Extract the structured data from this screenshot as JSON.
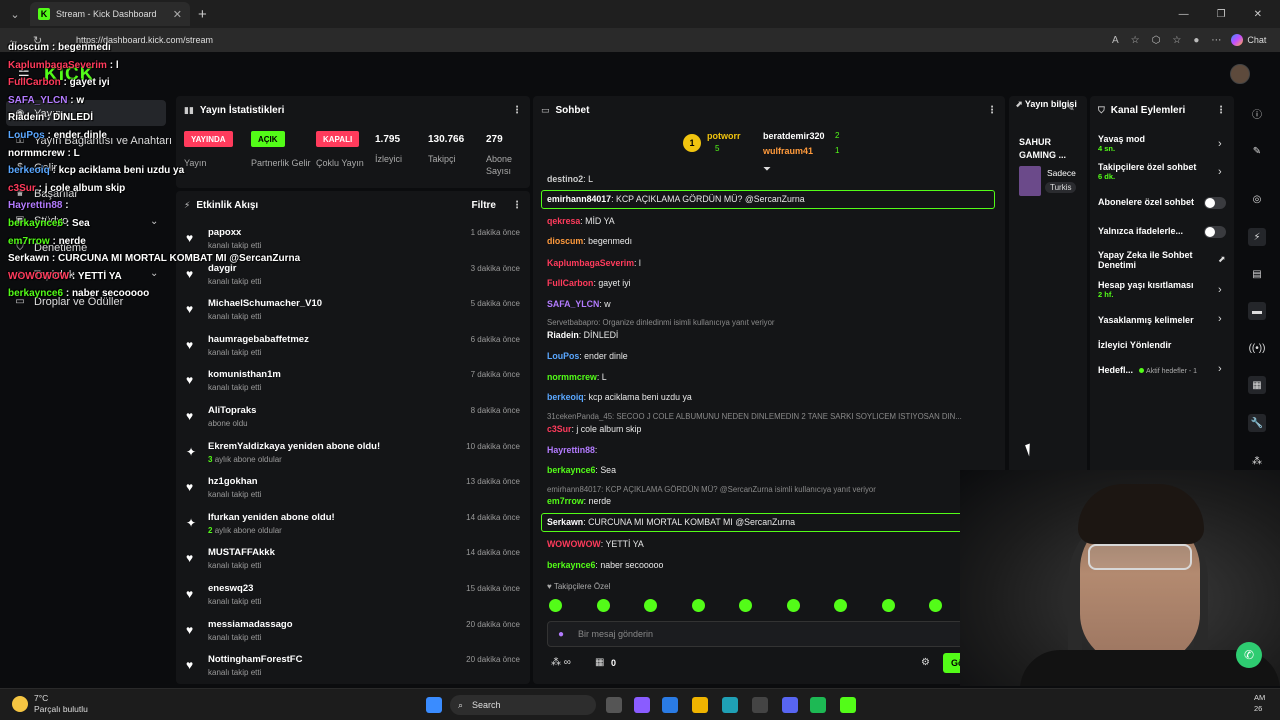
{
  "browser": {
    "tab_title": "Stream - Kick Dashboard",
    "tab_favicon": "K",
    "url": "https://dashboard.kick.com/stream",
    "chat_button": "Chat"
  },
  "kick": {
    "logo": "KICK"
  },
  "leftnav": {
    "items": [
      {
        "label": "Yayın"
      },
      {
        "label": "Yayın Bağlantısı ve Anahtarı"
      },
      {
        "label": "Gelir"
      },
      {
        "label": "Başarılar"
      },
      {
        "label": "Stüdyo"
      },
      {
        "label": "Denetleme"
      },
      {
        "label": "Topluluk"
      },
      {
        "label": "Droplar ve Ödüller"
      }
    ]
  },
  "overlay_chat": [
    {
      "user": "dioscum",
      "color": "#ffffff",
      "text": "begenmedı"
    },
    {
      "user": "KaplumbagaSeverim",
      "color": "#ff3b5c",
      "text": "l"
    },
    {
      "user": "FullCarbon",
      "color": "#ff3b5c",
      "text": "gayet iyi"
    },
    {
      "user": "SAFA_YLCN",
      "color": "#b37bff",
      "text": "w"
    },
    {
      "user": "Riadein",
      "color": "#ffffff",
      "text": "DİNLEDİ"
    },
    {
      "user": "LouPos",
      "color": "#5aa7ff",
      "text": "ender dinle"
    },
    {
      "user": "normmcrew",
      "color": "#ffffff",
      "text": "L"
    },
    {
      "user": "berkeoiq",
      "color": "#5aa7ff",
      "text": "kcp aciklama beni uzdu ya"
    },
    {
      "user": "c3Sur",
      "color": "#ff3b5c",
      "text": "j cole album skip"
    },
    {
      "user": "Hayrettin88",
      "color": "#b37bff",
      "text": ""
    },
    {
      "user": "berkaynce6",
      "color": "#53fc18",
      "text": "Sea"
    },
    {
      "user": "em7rrow",
      "color": "#53fc18",
      "text": "nerde"
    },
    {
      "user": "Serkawn",
      "color": "#ffffff",
      "text": "CURCUNA MI MORTAL KOMBAT MI @SercanZurna"
    },
    {
      "user": "WOWOWOW",
      "color": "#ff3b5c",
      "text": "YETTİ YA"
    },
    {
      "user": "berkaynce6",
      "color": "#53fc18",
      "text": "naber secooooo"
    }
  ],
  "stats": {
    "title": "Yayın İstatistikleri",
    "items": [
      {
        "badge": "YAYINDA",
        "badge_color": "#ff3b5c",
        "label": "Yayın"
      },
      {
        "badge": "AÇIK",
        "badge_color": "#53fc18",
        "label": "Partnerlik Gelir"
      },
      {
        "badge": "KAPALI",
        "badge_color": "#ff3b5c",
        "label": "Çoklu Yayın"
      },
      {
        "value": "1.795",
        "label": "İzleyici"
      },
      {
        "value": "130.766",
        "label": "Takipçi"
      },
      {
        "value": "279",
        "label": "Abone Sayısı"
      }
    ]
  },
  "activity": {
    "title": "Etkinlik Akışı",
    "filter_label": "Filtre",
    "items": [
      {
        "icon": "heart",
        "name": "papoxx",
        "sub": "kanalı takip etti",
        "time": "1 dakika önce"
      },
      {
        "icon": "heart",
        "name": "daygir",
        "sub": "kanalı takip etti",
        "time": "3 dakika önce"
      },
      {
        "icon": "heart",
        "name": "MichaelSchumacher_V10",
        "sub": "kanalı takip etti",
        "time": "5 dakika önce"
      },
      {
        "icon": "heart",
        "name": "haumragebabaffetmez",
        "sub": "kanalı takip etti",
        "time": "6 dakika önce"
      },
      {
        "icon": "heart",
        "name": "komunisthan1m",
        "sub": "kanalı takip etti",
        "time": "7 dakika önce"
      },
      {
        "icon": "heart",
        "name": "AliTopraks",
        "sub": "abone oldu",
        "time": "8 dakika önce"
      },
      {
        "icon": "sparkle",
        "name": "EkremYaldizkaya yeniden abone oldu!",
        "sub_num": "3",
        "sub": "aylık abone oldular",
        "time": "10 dakika önce"
      },
      {
        "icon": "heart",
        "name": "hz1gokhan",
        "sub": "kanalı takip etti",
        "time": "13 dakika önce"
      },
      {
        "icon": "sparkle",
        "name": "Ifurkan yeniden abone oldu!",
        "sub_num": "2",
        "sub": "aylık abone oldular",
        "time": "14 dakika önce"
      },
      {
        "icon": "heart",
        "name": "MUSTAFFAkkk",
        "sub": "kanalı takip etti",
        "time": "14 dakika önce"
      },
      {
        "icon": "heart",
        "name": "eneswq23",
        "sub": "kanalı takip etti",
        "time": "15 dakika önce"
      },
      {
        "icon": "heart",
        "name": "messiamadassago",
        "sub": "kanalı takip etti",
        "time": "20 dakika önce"
      },
      {
        "icon": "heart",
        "name": "NottinghamForestFC",
        "sub": "kanalı takip etti",
        "time": "20 dakika önce"
      }
    ]
  },
  "chat": {
    "title": "Sohbet",
    "leaderboard": [
      {
        "rank": "1",
        "name": "potworr",
        "count": "5"
      },
      {
        "name": "beratdemir320",
        "count": "2"
      },
      {
        "name": "wulfraum41",
        "count": "1"
      }
    ],
    "messages": [
      {
        "type": "msg",
        "user": "destino2",
        "color": "#cccccc",
        "text": "L"
      },
      {
        "type": "msg",
        "user": "emirhann84017",
        "color": "#ffffff",
        "text": "KCP AÇIKLAMA GÖRDÜN MÜ? @SercanZurna",
        "highlight": true
      },
      {
        "type": "msg",
        "user": "qekresa",
        "color": "#ff3b5c",
        "text": "MİD YA"
      },
      {
        "type": "msg",
        "user": "dioscum",
        "color": "#ff9a3c",
        "text": "begenmedı"
      },
      {
        "type": "msg",
        "user": "KaplumbagaSeverim",
        "color": "#ff3b5c",
        "text": "l"
      },
      {
        "type": "msg",
        "user": "FullCarbon",
        "color": "#ff3b5c",
        "text": "gayet iyi"
      },
      {
        "type": "msg",
        "user": "SAFA_YLCN",
        "color": "#b37bff",
        "text": "w"
      },
      {
        "type": "reply",
        "text": "Servetbabapro: Organize dinledinmi isimli kullanıcıya yanıt veriyor"
      },
      {
        "type": "msg",
        "user": "Riadein",
        "color": "#ffffff",
        "text": "DİNLEDİ"
      },
      {
        "type": "msg",
        "user": "LouPos",
        "color": "#5aa7ff",
        "text": "ender dinle"
      },
      {
        "type": "msg",
        "user": "normmcrew",
        "color": "#53fc18",
        "text": "L"
      },
      {
        "type": "msg",
        "user": "berkeoiq",
        "color": "#5aa7ff",
        "text": "kcp aciklama beni uzdu ya"
      },
      {
        "type": "reply",
        "text": "31cekenPanda_45: SECOO J COLE ALBUMUNU NEDEN DINLEMEDIN 2 TANE SARKI SOYLICEM ISTIYOSAN DIN..."
      },
      {
        "type": "msg",
        "user": "c3Sur",
        "color": "#ff3b5c",
        "text": "j cole album skip"
      },
      {
        "type": "msg",
        "user": "Hayrettin88",
        "color": "#b37bff",
        "text": ""
      },
      {
        "type": "msg",
        "user": "berkaynce6",
        "color": "#53fc18",
        "text": "Sea"
      },
      {
        "type": "reply",
        "text": "emirhann84017: KCP AÇIKLAMA GÖRDÜN MÜ? @SercanZurna isimli kullanıcıya yanıt veriyor"
      },
      {
        "type": "msg",
        "user": "em7rrow",
        "color": "#53fc18",
        "text": "nerde"
      },
      {
        "type": "msg",
        "user": "Serkawn",
        "color": "#ffffff",
        "text": "CURCUNA MI MORTAL KOMBAT MI @SercanZurna",
        "highlight": true
      },
      {
        "type": "msg",
        "user": "WOWOWOW",
        "color": "#ff3b5c",
        "text": "YETTİ YA"
      },
      {
        "type": "msg",
        "user": "berkaynce6",
        "color": "#53fc18",
        "text": "naber secooooo"
      }
    ],
    "followers_only": "Takipçilere Özel",
    "input_placeholder": "Bir mesaj gönderin",
    "points": "0",
    "send_label": "Gönder"
  },
  "stream_info": {
    "title": "Yayın bilgisi",
    "stream_title": "SAHUR GAMING ...",
    "preview_text": "Sadece",
    "tag": "Turkis"
  },
  "channel_actions": {
    "title": "Kanal Eylemleri",
    "items": [
      {
        "label": "Yavaş mod",
        "sub": "4 sn.",
        "control": "chevron"
      },
      {
        "label": "Takipçilere özel sohbet",
        "sub": "6 dk.",
        "control": "chevron"
      },
      {
        "label": "Abonelere özel sohbet",
        "control": "toggle"
      },
      {
        "label": "Yalnızca ifadelerle...",
        "control": "toggle"
      },
      {
        "label": "Yapay Zeka ile Sohbet Denetimi",
        "control": "external"
      },
      {
        "label": "Hesap yaşı kısıtlaması",
        "sub": "2 hf.",
        "control": "chevron"
      },
      {
        "label": "Yasaklanmış kelimeler",
        "control": "chevron"
      },
      {
        "label": "İzleyici Yönlendir",
        "control": "none"
      },
      {
        "label": "Hedefl...",
        "sub_inline": "Aktif hedefler - 1",
        "control": "chevron"
      }
    ]
  },
  "taskbar": {
    "temp": "7°C",
    "weather": "Parçalı bulutlu",
    "search": "Search",
    "clock_top": "AM",
    "clock_bottom": "26"
  },
  "colors": {
    "accent": "#53fc18",
    "live": "#ff3b5c",
    "panel": "#141517",
    "bg": "#0b0c0e"
  }
}
